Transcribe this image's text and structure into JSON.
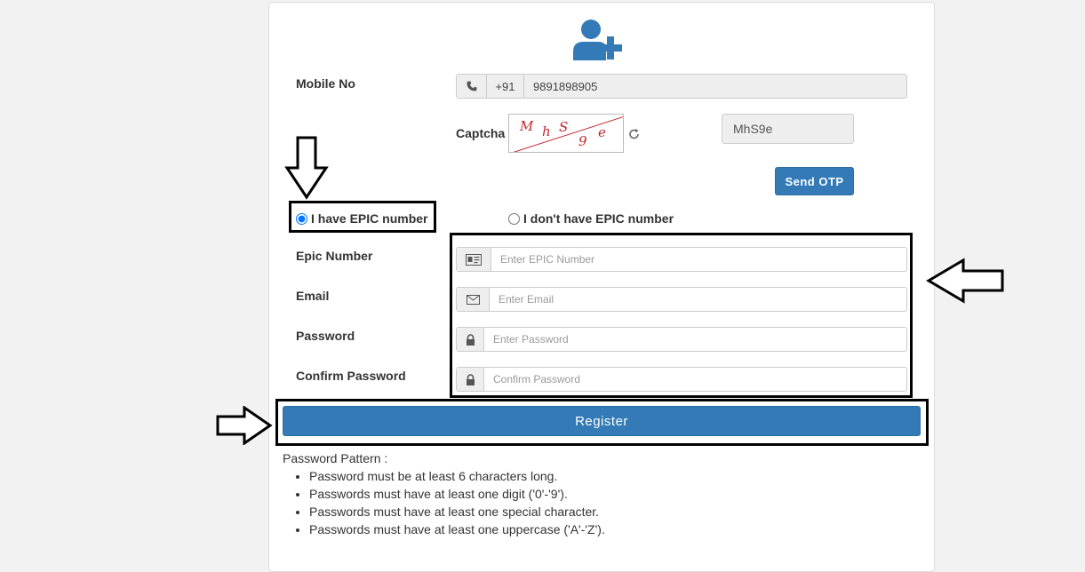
{
  "form": {
    "mobile_label": "Mobile No",
    "country_code": "+91",
    "mobile_value": "9891898905",
    "captcha_label": "Captcha",
    "captcha_chars": [
      "M",
      "h",
      "S",
      "9",
      "e"
    ],
    "captcha_value": "MhS9e",
    "send_otp_label": "Send OTP",
    "radio_have_epic": "I have EPIC number",
    "radio_no_epic": "I don't have EPIC number",
    "epic_label": "Epic Number",
    "epic_placeholder": "Enter EPIC Number",
    "email_label": "Email",
    "email_placeholder": "Enter Email",
    "password_label": "Password",
    "password_placeholder": "Enter Password",
    "confirm_label": "Confirm Password",
    "confirm_placeholder": "Confirm Password",
    "register_label": "Register"
  },
  "password_pattern": {
    "heading": "Password Pattern :",
    "rules": [
      "Password must be at least 6 characters long.",
      "Passwords must have at least one digit ('0'-'9').",
      "Passwords must have at least one special character.",
      "Passwords must have at least one uppercase ('A'-'Z')."
    ]
  },
  "icons": {
    "header": "user-plus-icon",
    "phone": "phone-icon",
    "refresh": "refresh-icon",
    "id_card": "id-card-icon",
    "envelope": "envelope-icon",
    "lock": "lock-icon"
  },
  "colors": {
    "primary": "#337ab7",
    "captcha_text": "#c0262d",
    "annotation": "#000000"
  }
}
